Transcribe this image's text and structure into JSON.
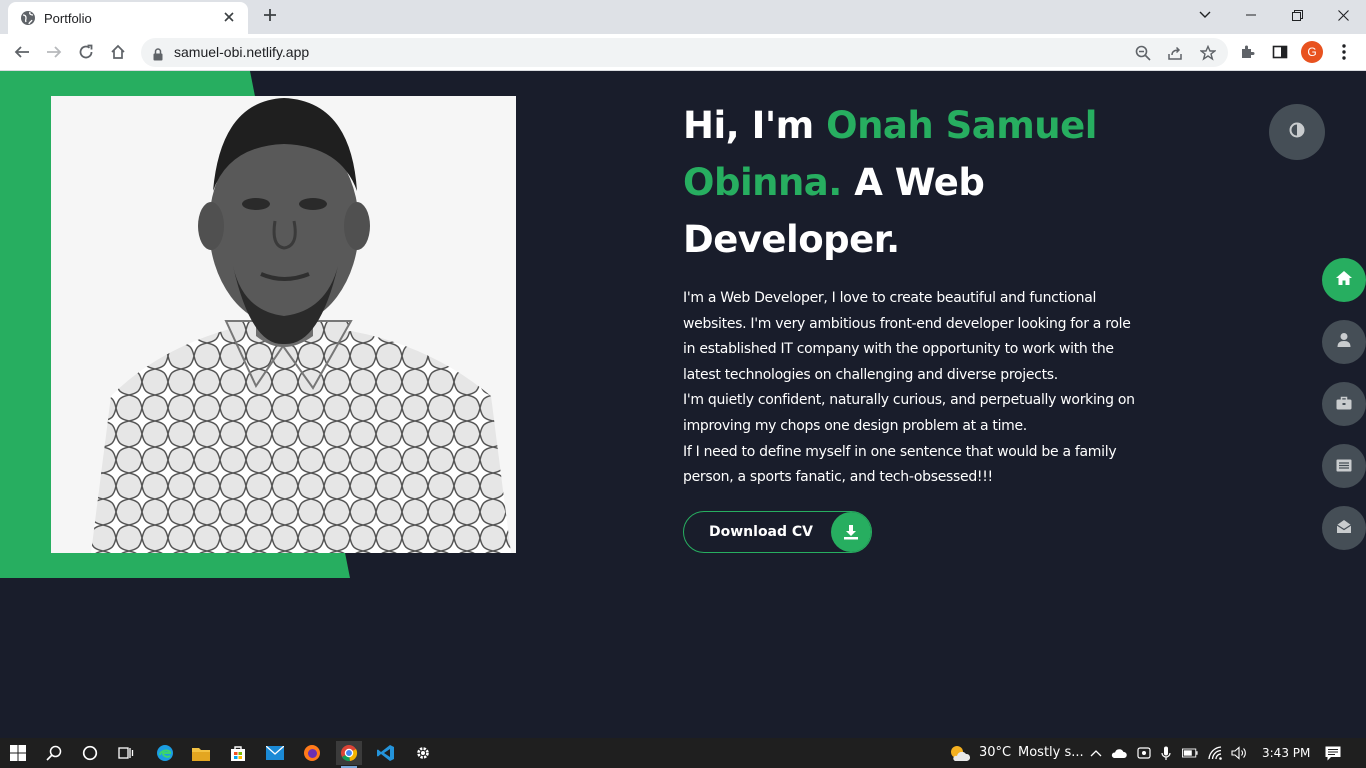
{
  "browser": {
    "tab_title": "Portfolio",
    "url": "samuel-obi.netlify.app",
    "profile_initial": "G"
  },
  "hero": {
    "greeting": "Hi, I'm ",
    "name": "Onah Samuel Obinna.",
    "role": " A Web Developer.",
    "paragraphs": [
      "I'm a Web Developer, I love to create beautiful and functional websites. I'm very ambitious front-end developer looking for a role in established IT company with the opportunity to work with the latest technologies on challenging and diverse projects.",
      "I'm quietly confident, naturally curious, and perpetually working on improving my chops one design problem at a time.",
      "If I need to define myself in one sentence that would be a family person, a sports fanatic, and tech-obsessed!!!"
    ],
    "cv_button": "Download CV"
  },
  "side_nav": [
    {
      "icon": "home-icon",
      "active": true
    },
    {
      "icon": "user-icon",
      "active": false
    },
    {
      "icon": "briefcase-icon",
      "active": false
    },
    {
      "icon": "newspaper-icon",
      "active": false
    },
    {
      "icon": "envelope-open-icon",
      "active": false
    }
  ],
  "taskbar": {
    "temperature": "30°C",
    "weather": "Mostly s...",
    "time": "3:43 PM"
  },
  "colors": {
    "accent": "#27ae60",
    "background": "#191d2b",
    "nav_button": "#454e56"
  }
}
